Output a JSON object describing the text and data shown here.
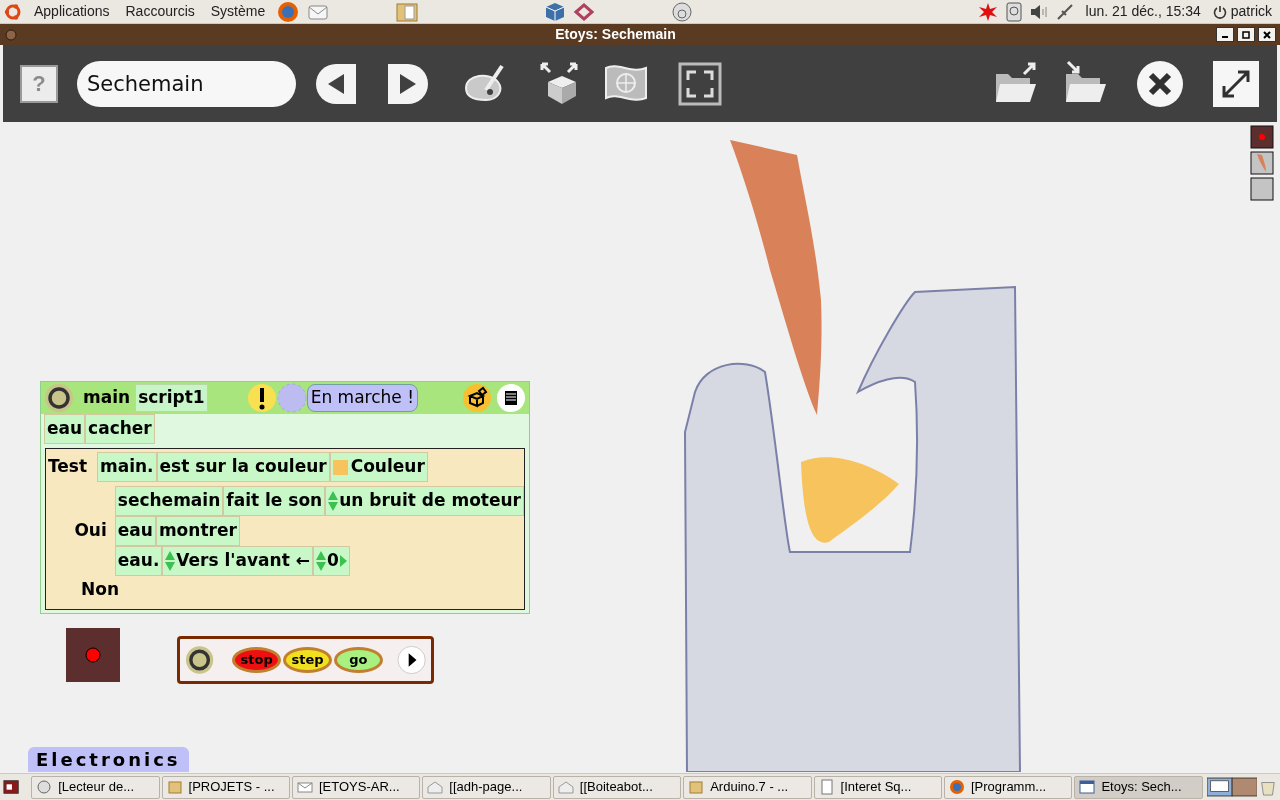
{
  "top_panel": {
    "menus": [
      "Applications",
      "Raccourcis",
      "Système"
    ],
    "clock": "lun. 21 déc., 15:34",
    "user": "patrick"
  },
  "window": {
    "title": "Etoys: Sechemain"
  },
  "toolbar": {
    "help": "?",
    "project_name": "Sechemain"
  },
  "script": {
    "owner": "main",
    "name": "script1",
    "status": "En marche !",
    "rows": [
      [
        {
          "text": "eau",
          "kind": "plain"
        },
        {
          "text": "cacher",
          "kind": "plain"
        }
      ]
    ],
    "test": {
      "label": "Test",
      "tiles": [
        {
          "text": "main.",
          "kind": "plain"
        },
        {
          "text": "est sur la couleur",
          "kind": "plain"
        },
        {
          "text": "Couleur",
          "kind": "color",
          "color": "#f6c35c"
        }
      ],
      "yes_label": "Oui",
      "yes_rows": [
        [
          {
            "text": "sechemain",
            "kind": "plain"
          },
          {
            "text": "fait le son",
            "kind": "plain"
          },
          {
            "text": "un bruit de moteur",
            "kind": "choice"
          }
        ],
        [
          {
            "text": "eau",
            "kind": "plain"
          },
          {
            "text": "montrer",
            "kind": "plain"
          }
        ],
        [
          {
            "text": "eau.",
            "kind": "plain"
          },
          {
            "text": "Vers l'avant ←",
            "kind": "choice"
          },
          {
            "text": "0",
            "kind": "number"
          }
        ]
      ],
      "no_label": "Non"
    }
  },
  "controls": {
    "buttons": [
      "stop",
      "step",
      "go"
    ]
  },
  "flap": {
    "label": "Electronics"
  },
  "taskbar": [
    {
      "label": "[Lecteur de...",
      "selected": false
    },
    {
      "label": "[PROJETS - ...",
      "selected": false
    },
    {
      "label": "[ETOYS-AR...",
      "selected": false
    },
    {
      "label": "[[adh-page...",
      "selected": false
    },
    {
      "label": "[[Boiteabot...",
      "selected": false
    },
    {
      "label": "Arduino.7 - ...",
      "selected": false
    },
    {
      "label": "[Interet Sq...",
      "selected": false
    },
    {
      "label": "[Programm...",
      "selected": false
    },
    {
      "label": "Etoys: Sech...",
      "selected": true
    }
  ]
}
